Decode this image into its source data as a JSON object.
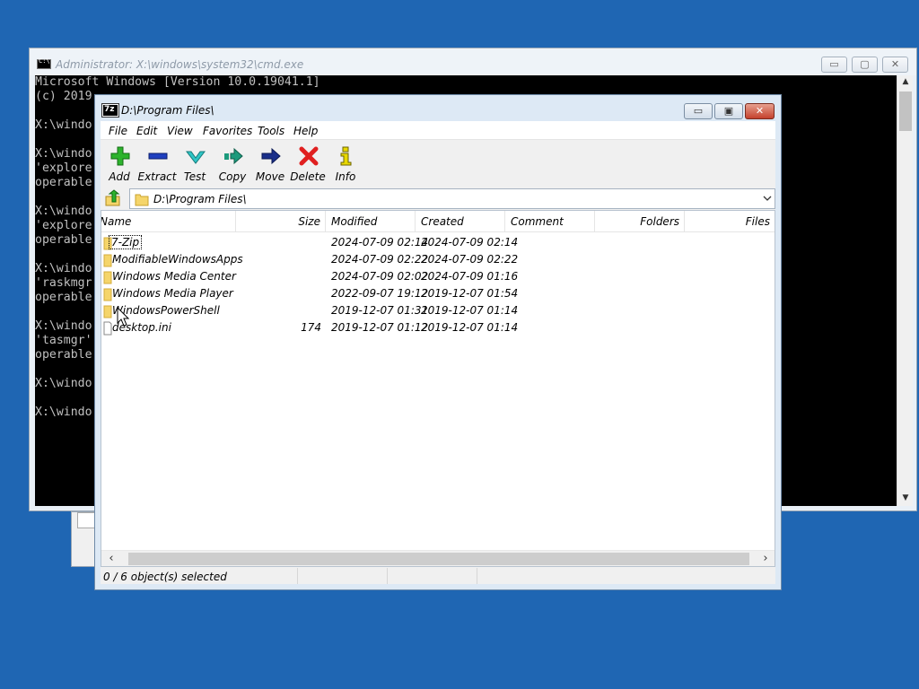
{
  "cmd": {
    "title": "Administrator: X:\\windows\\system32\\cmd.exe",
    "buttons": {
      "minimize": "▭",
      "maximize": "▢",
      "close": "✕"
    },
    "lines": [
      "Microsoft Windows [Version 10.0.19041.1]",
      "(c) 2019",
      "",
      "X:\\windo",
      "",
      "X:\\windo",
      "'explore",
      "operable",
      "",
      "X:\\windo",
      "'explore",
      "operable",
      "",
      "X:\\windo",
      "'raskmgr",
      "operable",
      "",
      "X:\\windo",
      "'tasmgr'",
      "operable",
      "",
      "X:\\windo",
      "",
      "X:\\windo"
    ]
  },
  "zip": {
    "title": "D:\\Program Files\\",
    "icon_text": "7z",
    "buttons": {
      "minimize": "▭",
      "maximize": "▣",
      "close": "✕"
    },
    "menu": [
      "File",
      "Edit",
      "View",
      "Favorites",
      "Tools",
      "Help"
    ],
    "toolbar": [
      {
        "label": "Add",
        "icon": "plus-icon",
        "color": "#2db32d"
      },
      {
        "label": "Extract",
        "icon": "minus-icon",
        "color": "#1f3fbf"
      },
      {
        "label": "Test",
        "icon": "check-icon",
        "color": "#2fc6c6"
      },
      {
        "label": "Copy",
        "icon": "copy-arrow-icon",
        "color": "#1c9a7c"
      },
      {
        "label": "Move",
        "icon": "move-arrow-icon",
        "color": "#1a2f8a"
      },
      {
        "label": "Delete",
        "icon": "x-icon",
        "color": "#e02020"
      },
      {
        "label": "Info",
        "icon": "info-icon",
        "color": "#e8d800"
      }
    ],
    "address": "D:\\Program Files\\",
    "columns": [
      "Name",
      "Size",
      "Modified",
      "Created",
      "Comment",
      "Folders",
      "Files"
    ],
    "rows": [
      {
        "name": "7-Zip",
        "size": "",
        "modified": "2024-07-09 02:14",
        "created": "2024-07-09 02:14",
        "type": "folder"
      },
      {
        "name": "ModifiableWindowsApps",
        "size": "",
        "modified": "2024-07-09 02:22",
        "created": "2024-07-09 02:22",
        "type": "folder"
      },
      {
        "name": "Windows Media Center",
        "size": "",
        "modified": "2024-07-09 02:02",
        "created": "2024-07-09 01:16",
        "type": "folder"
      },
      {
        "name": "Windows Media Player",
        "size": "",
        "modified": "2022-09-07 19:12",
        "created": "2019-12-07 01:54",
        "type": "folder"
      },
      {
        "name": "WindowsPowerShell",
        "size": "",
        "modified": "2019-12-07 01:31",
        "created": "2019-12-07 01:14",
        "type": "folder"
      },
      {
        "name": "desktop.ini",
        "size": "174",
        "modified": "2019-12-07 01:12",
        "created": "2019-12-07 01:14",
        "type": "file"
      }
    ],
    "status": "0 / 6 object(s) selected",
    "colors": {
      "folder": "#f5d56a",
      "desktop": "#1f66b3"
    }
  }
}
